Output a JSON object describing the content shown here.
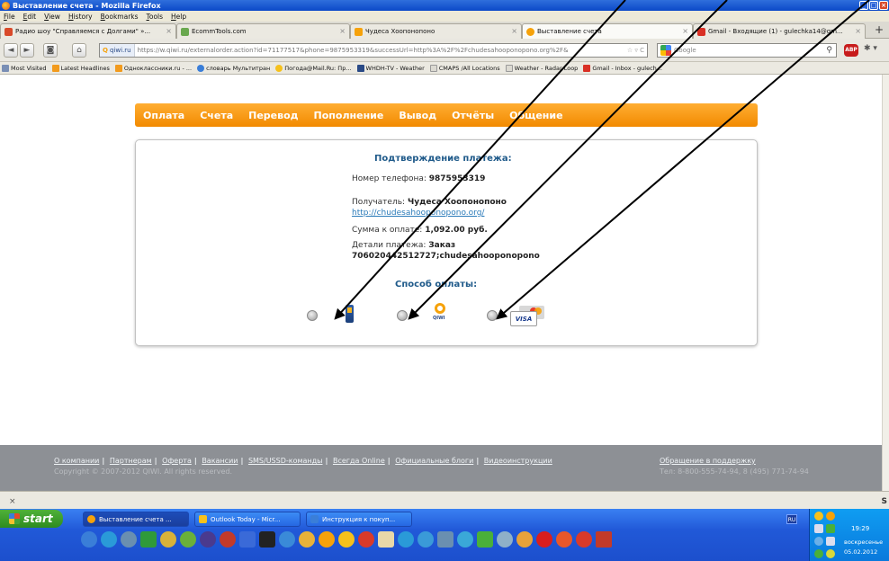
{
  "window": {
    "title": "Выставление счета - Mozilla Firefox",
    "buttons": [
      "_",
      "□",
      "×"
    ]
  },
  "menu": [
    "File",
    "Edit",
    "View",
    "History",
    "Bookmarks",
    "Tools",
    "Help"
  ],
  "tabs": [
    {
      "label": "Радио шоу \"Справляемся с Долгами\" »...",
      "close": "×",
      "color": "#d94a2a"
    },
    {
      "label": "EcommTools.com",
      "close": "×",
      "color": "#6aa84f"
    },
    {
      "label": "Чудеса Хоопонопоно",
      "close": "×",
      "color": "#f6a20a"
    },
    {
      "label": "Выставление счета",
      "close": "×",
      "color": "#f6a20a"
    },
    {
      "label": "Gmail - Входящие (1) - gulechka14@gm...",
      "close": "×",
      "color": "#d93025"
    }
  ],
  "new_tab": "+",
  "nav": {
    "back": "◄",
    "forward": "►",
    "identity": "◙",
    "home": "⌂",
    "site": "qiwi.ru",
    "url": "https://w.qiwi.ru/externalorder.action?id=71177517&phone=9875953319&successUrl=http%3A%2F%2Fchudesahooponopono.org%2F&",
    "url_suffix": "☆ ▿ C",
    "search_placeholder": "Google",
    "search_icon": "⚲",
    "abp": "ABP",
    "extra": "✱ ▾"
  },
  "bookmarks": [
    {
      "label": "Most Visited",
      "color": "#7a8fb5"
    },
    {
      "label": "Latest Headlines",
      "color": "#f29b1d"
    },
    {
      "label": "Одноклассники.ru - ...",
      "color": "#f29b1d"
    },
    {
      "label": "словарь Мультитран",
      "color": "#3a7ed8"
    },
    {
      "label": "Погода@Mail.Ru: Пр...",
      "color": "#f6c11c"
    },
    {
      "label": "WHDH-TV - Weather",
      "color": "#2a4a86"
    },
    {
      "label": "CMAPS /All Locations",
      "color": "#dcdad2"
    },
    {
      "label": "Weather - Radar Loop",
      "color": "#dcdad2"
    },
    {
      "label": "Gmail - Inbox - gulech...",
      "color": "#d93025"
    }
  ],
  "qiwi_nav": [
    "Оплата",
    "Счета",
    "Перевод",
    "Пополнение",
    "Вывод",
    "Отчёты",
    "Общение"
  ],
  "confirm": {
    "title": "Подтверждение платежа:",
    "phone_label": "Номер телефона:",
    "phone_value": "9875953319",
    "recipient_label": "Получатель:",
    "recipient_value": "Чудеса Хоопонопоно",
    "recipient_link": "http://chudesahooponopono.org/",
    "amount_label": "Сумма к оплате:",
    "amount_value": "1,092.00 руб.",
    "details_label": "Детали платежа:",
    "details_value_1": "Заказ",
    "details_value_2": "706020442512727;chudesahooponopono",
    "method_title": "Способ оплаты:",
    "qiwi_text": "QIWI",
    "visa_text": "VISA"
  },
  "footer": {
    "links": [
      "О компании",
      "Партнерам",
      "Оферта",
      "Вакансии",
      "SMS/USSD-команды",
      "Всегда Online",
      "Официальные блоги",
      "Видеоинструкции"
    ],
    "separator": "|",
    "copyright": "Copyright © 2007-2012 QIWI. All rights reserved.",
    "support": "Обращение в поддержку",
    "phones": "Тел: 8-800-555-74-94, 8 (495) 771-74-94"
  },
  "statusbar": {
    "close": "×",
    "right": "S"
  },
  "taskbar": {
    "start": "start",
    "tasks": [
      {
        "label": "Выставление счета ...",
        "color": "#f6a20a"
      },
      {
        "label": "Outlook Today - Micr...",
        "color": "#f6c11c"
      },
      {
        "label": "Инструкция к покуп...",
        "color": "#3a7ed8"
      }
    ],
    "lang": "RU",
    "time": "19:29",
    "day": "воскресенье",
    "date": "05.02.2012"
  }
}
